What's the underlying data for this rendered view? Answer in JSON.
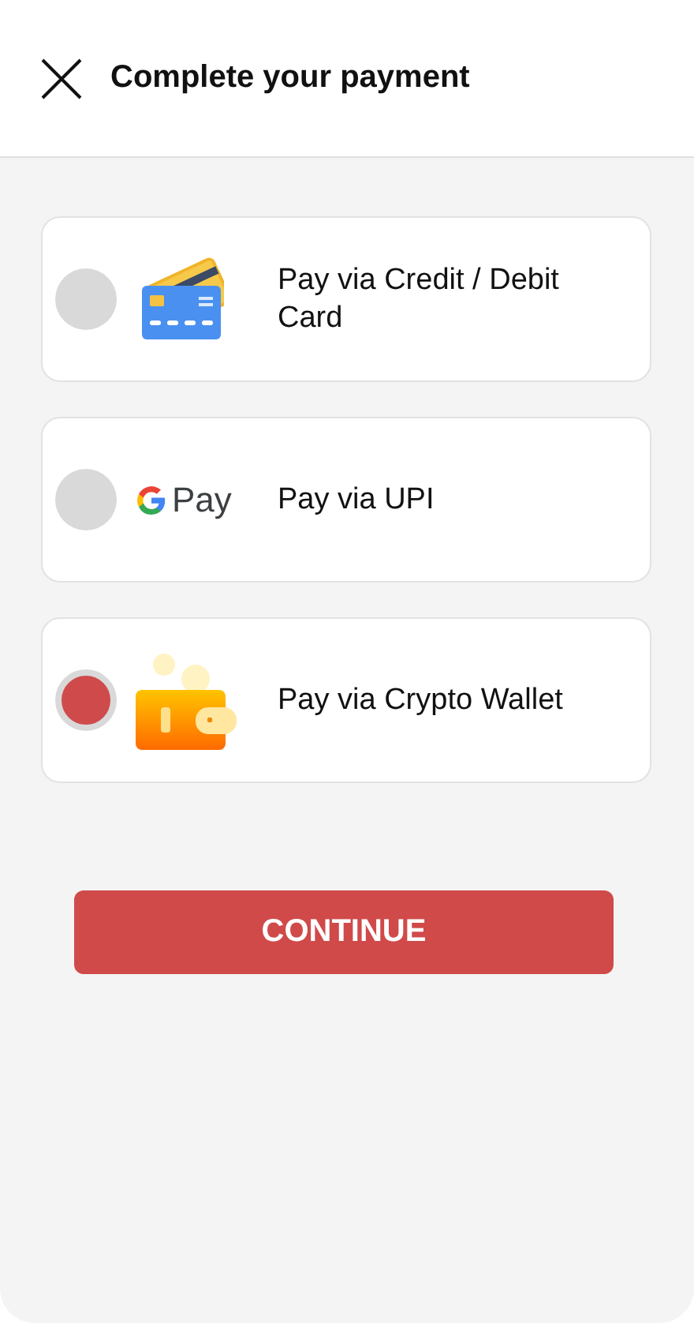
{
  "header": {
    "title": "Complete your payment"
  },
  "options": [
    {
      "kind": "card",
      "label": "Pay via Credit / Debit Card",
      "selected": false
    },
    {
      "kind": "upi",
      "logo_text": "Pay",
      "label": "Pay via UPI",
      "selected": false
    },
    {
      "kind": "wallet",
      "label": "Pay via Crypto Wallet",
      "selected": true
    }
  ],
  "button": {
    "label": "CONTINUE"
  }
}
